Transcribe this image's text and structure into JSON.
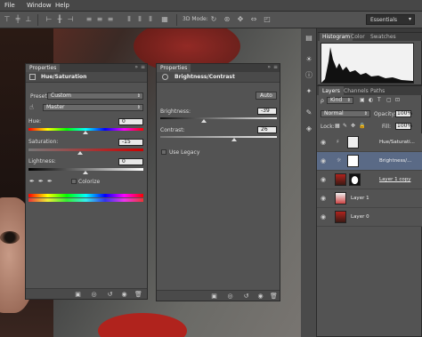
{
  "menu": {
    "items": [
      "File",
      "Window",
      "Help"
    ]
  },
  "options_bar": {
    "mode_label": "3D Mode:",
    "workspace": "Essentials"
  },
  "hue_sat_panel": {
    "tab_label": "Properties",
    "title": "Hue/Saturation",
    "preset_label": "Preset:",
    "preset_value": "Custom",
    "channel_value": "Master",
    "hue_label": "Hue:",
    "hue_value": "0",
    "saturation_label": "Saturation:",
    "saturation_value": "-15",
    "lightness_label": "Lightness:",
    "lightness_value": "0",
    "colorize_label": "Colorize",
    "colorize_checked": false
  },
  "bc_panel": {
    "tab_label": "Properties",
    "title": "Brightness/Contrast",
    "auto_label": "Auto",
    "brightness_label": "Brightness:",
    "brightness_value": "-39",
    "contrast_label": "Contrast:",
    "contrast_value": "26",
    "legacy_label": "Use Legacy",
    "legacy_checked": false
  },
  "histogram_panel": {
    "tabs": [
      "Histogram",
      "Color",
      "Swatches"
    ]
  },
  "layers_panel": {
    "tabs": [
      "Layers",
      "Channels",
      "Paths"
    ],
    "filter_value": "Kind",
    "blend_mode": "Normal",
    "opacity_label": "Opacity:",
    "opacity_value": "100%",
    "lock_label": "Lock:",
    "fill_label": "Fill:",
    "fill_value": "100%",
    "layers": [
      {
        "name": "Hue/Saturati...",
        "selected": false
      },
      {
        "name": "Brightness/...",
        "selected": true
      },
      {
        "name": "Layer 1 copy",
        "selected": false
      },
      {
        "name": "Layer 1",
        "selected": false
      },
      {
        "name": "Layer 0",
        "selected": false
      }
    ]
  },
  "colors": {
    "panel_bg": "#535353",
    "selection": "#5a6a86",
    "hood_red": "#b0231d"
  }
}
